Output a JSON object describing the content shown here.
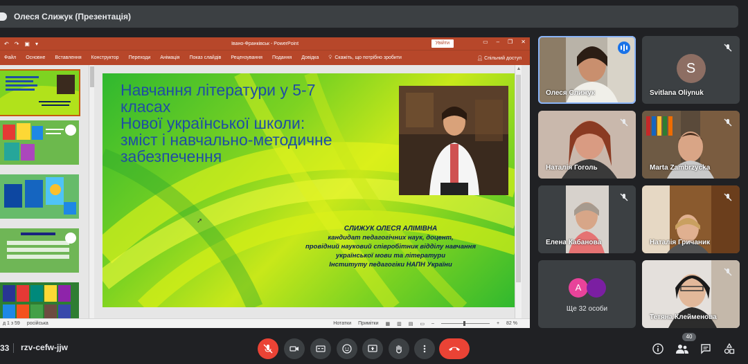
{
  "topbar": {
    "presenter_title": "Олеся Слижук (Презентація)"
  },
  "ppt": {
    "window_title": "Івано-Франківськ  -  PowerPoint",
    "signin_label": "Увійти",
    "ribbon_tabs": [
      "Файл",
      "Основне",
      "Вставлення",
      "Конструктор",
      "Переходи",
      "Анімація",
      "Показ слайдів",
      "Рецензування",
      "Подання",
      "Довідка"
    ],
    "tell_me": "Скажіть, що потрібно зробити",
    "share": "Спільний доступ",
    "slide": {
      "title_lines": [
        "Навчання літератури у 5-7",
        "класах",
        "Нової української школи:",
        "зміст і навчально-методичне",
        "забезпечення"
      ],
      "author_lines": [
        "СЛИЖУК ОЛЕСЯ АЛІМІВНА",
        "кандидат педагогічних наук, доцент,",
        "провідний науковий співробітник відділу навчання",
        "української мови та літератури",
        "Інституту педагогіки НАПН України"
      ]
    },
    "status": {
      "slide_counter": "д 1 з 59",
      "language": "російська",
      "notes": "Нотатки",
      "comments": "Примітки",
      "zoom": "82 %"
    }
  },
  "participants": [
    {
      "name": "Олеся Слижук",
      "speaking": true
    },
    {
      "name": "Svitlana Oliynuk",
      "initial": "S"
    },
    {
      "name": "Наталія Гоголь"
    },
    {
      "name": "Marta Zambrzycka"
    },
    {
      "name": "Елена Кабанова"
    },
    {
      "name": "Наталія Гричаник"
    },
    {
      "name": "Ще 32 особи",
      "initial": "A"
    },
    {
      "name": "Тетяна Клейменова"
    }
  ],
  "bottombar": {
    "time": "33",
    "meeting_code": "rzv-cefw-jjw",
    "participant_count": "40"
  },
  "colors": {
    "meet_bg": "#202124",
    "tile_bg": "#3c4043",
    "ppt_accent": "#b7472a",
    "hangup": "#ea4335",
    "title_blue": "#1f4ea3"
  }
}
